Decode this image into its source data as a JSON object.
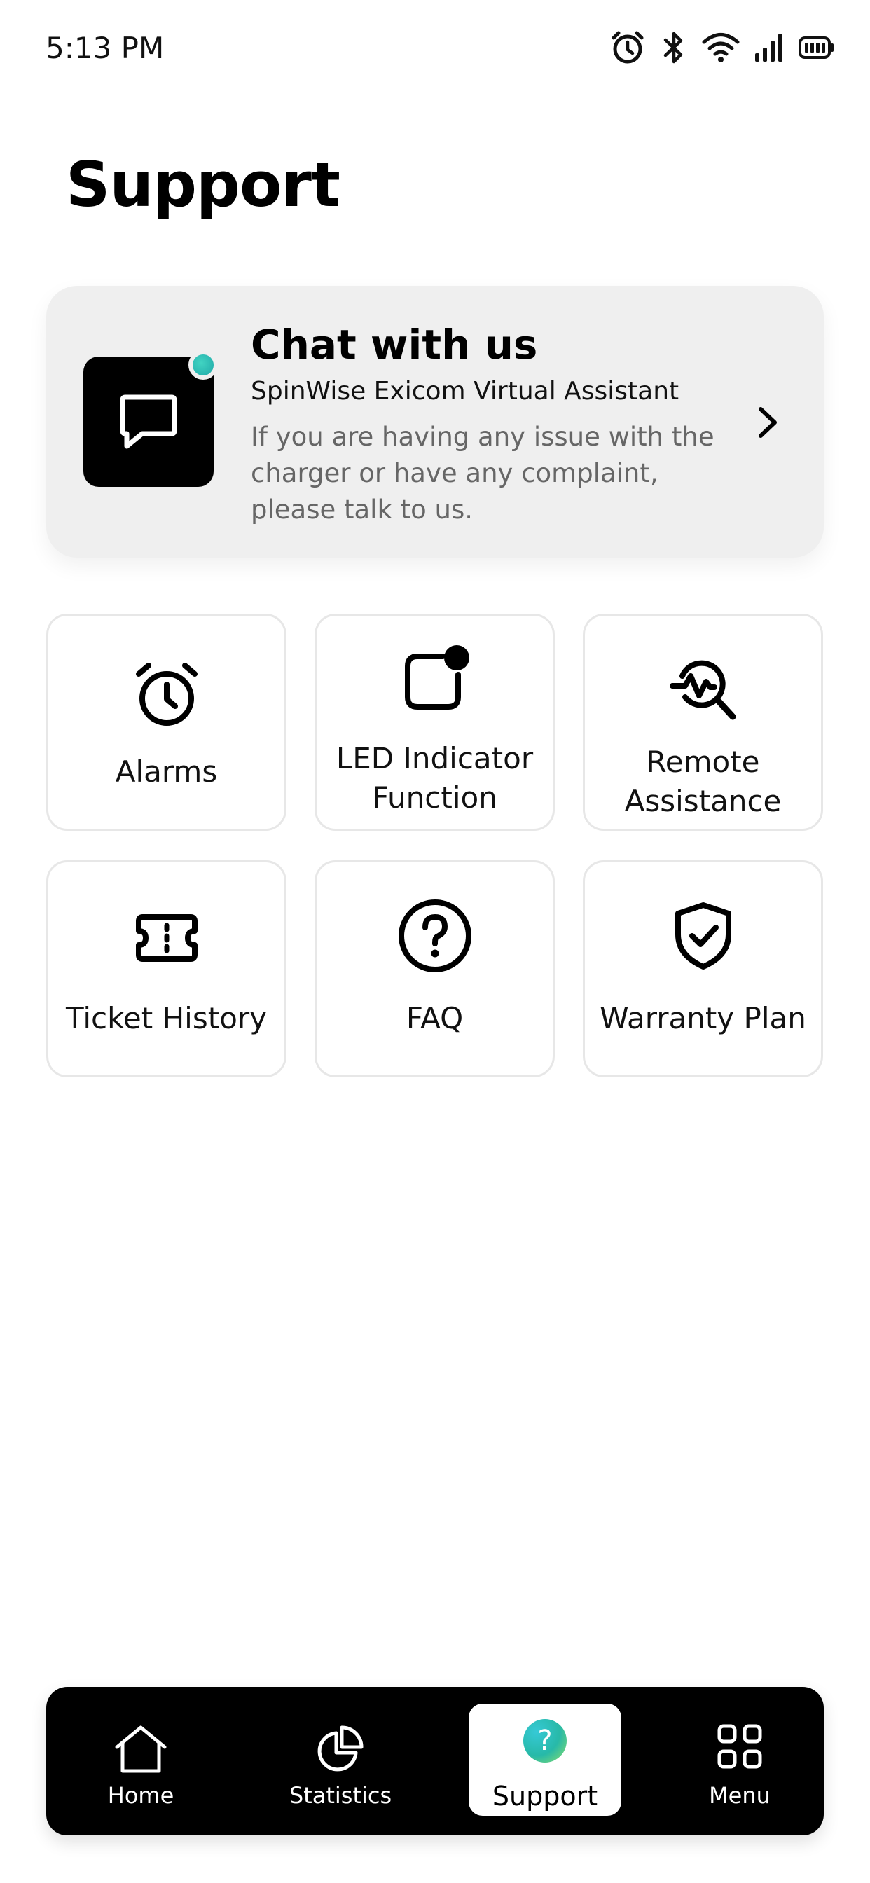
{
  "status_bar": {
    "time": "5:13 PM",
    "icons": [
      "alarm-icon",
      "bluetooth-icon",
      "wifi-icon",
      "signal-icon",
      "battery-icon"
    ]
  },
  "page": {
    "title": "Support"
  },
  "chat_card": {
    "title": "Chat with us",
    "subtitle": "SpinWise Exicom Virtual Assistant",
    "description": "If you are having any issue with the charger or have any complaint, please talk to us.",
    "icon": "chat-bubble-icon",
    "online_dot_color": "#2bb8b0"
  },
  "tiles": [
    {
      "label": "Alarms",
      "icon": "alarm-clock-icon"
    },
    {
      "label": "LED Indicator Function",
      "icon": "led-indicator-icon"
    },
    {
      "label": "Remote Assistance",
      "icon": "remote-assistance-icon"
    },
    {
      "label": "Ticket History",
      "icon": "ticket-icon"
    },
    {
      "label": "FAQ",
      "icon": "question-circle-icon"
    },
    {
      "label": "Warranty Plan",
      "icon": "shield-check-icon"
    }
  ],
  "bottom_nav": {
    "items": [
      {
        "label": "Home",
        "icon": "home-icon"
      },
      {
        "label": "Statistics",
        "icon": "pie-chart-icon"
      },
      {
        "label": "Support",
        "icon": "support-icon",
        "active": true
      },
      {
        "label": "Menu",
        "icon": "grid-icon"
      }
    ],
    "support_glyph": "?"
  }
}
